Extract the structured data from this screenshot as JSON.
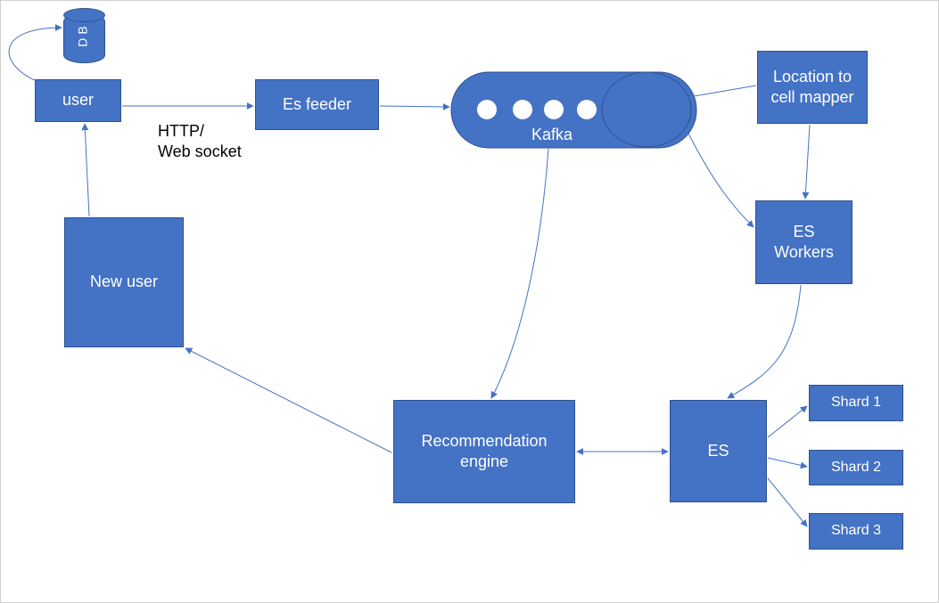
{
  "nodes": {
    "db": "DB",
    "user": "user",
    "new_user": "New user",
    "es_feeder": "Es feeder",
    "kafka": "Kafka",
    "loc_mapper": "Location to\ncell mapper",
    "es_workers": "ES\nWorkers",
    "reco": "Recommendation\nengine",
    "es": "ES",
    "shard1": "Shard 1",
    "shard2": "Shard 2",
    "shard3": "Shard 3"
  },
  "labels": {
    "http": "HTTP/\nWeb socket"
  },
  "colors": {
    "fill": "#4472C4",
    "stroke": "#2F528F"
  },
  "chart_data": {
    "type": "diagram",
    "nodes": [
      {
        "id": "db",
        "label": "DB",
        "shape": "cylinder"
      },
      {
        "id": "user",
        "label": "user",
        "shape": "rect"
      },
      {
        "id": "new_user",
        "label": "New user",
        "shape": "rect"
      },
      {
        "id": "es_feeder",
        "label": "Es feeder",
        "shape": "rect"
      },
      {
        "id": "kafka",
        "label": "Kafka",
        "shape": "capsule"
      },
      {
        "id": "loc_mapper",
        "label": "Location to cell mapper",
        "shape": "rect"
      },
      {
        "id": "es_workers",
        "label": "ES Workers",
        "shape": "rect"
      },
      {
        "id": "reco",
        "label": "Recommendation engine",
        "shape": "rect"
      },
      {
        "id": "es",
        "label": "ES",
        "shape": "rect"
      },
      {
        "id": "shard1",
        "label": "Shard 1",
        "shape": "rect"
      },
      {
        "id": "shard2",
        "label": "Shard 2",
        "shape": "rect"
      },
      {
        "id": "shard3",
        "label": "Shard 3",
        "shape": "rect"
      }
    ],
    "edges": [
      {
        "from": "user",
        "to": "db",
        "bidirectional": true,
        "style": "self-loop"
      },
      {
        "from": "user",
        "to": "es_feeder",
        "directed": true,
        "label": "HTTP/ Web socket"
      },
      {
        "from": "es_feeder",
        "to": "kafka",
        "directed": true
      },
      {
        "from": "kafka",
        "to": "loc_mapper",
        "directed": false
      },
      {
        "from": "kafka",
        "to": "es_workers",
        "directed": true,
        "style": "curve"
      },
      {
        "from": "loc_mapper",
        "to": "es_workers",
        "directed": true
      },
      {
        "from": "kafka",
        "to": "reco",
        "directed": true,
        "style": "curve"
      },
      {
        "from": "es_workers",
        "to": "es",
        "directed": true,
        "style": "curve"
      },
      {
        "from": "reco",
        "to": "es",
        "bidirectional": true
      },
      {
        "from": "reco",
        "to": "new_user",
        "directed": true
      },
      {
        "from": "new_user",
        "to": "user",
        "directed": true
      },
      {
        "from": "es",
        "to": "shard1",
        "directed": true
      },
      {
        "from": "es",
        "to": "shard2",
        "directed": true
      },
      {
        "from": "es",
        "to": "shard3",
        "directed": true
      }
    ]
  }
}
